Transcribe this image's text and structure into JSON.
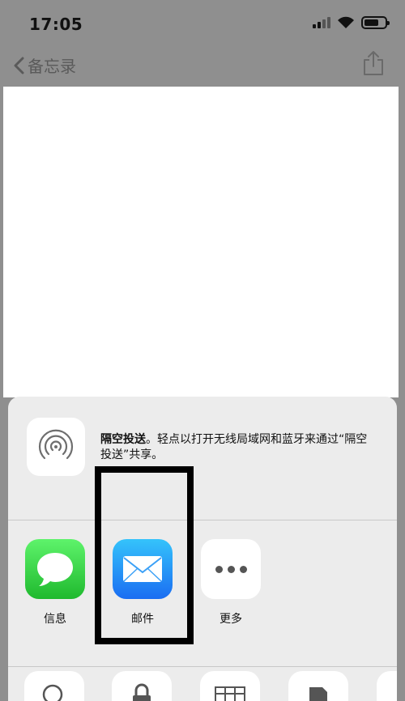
{
  "status_bar": {
    "time": "17:05",
    "signal_bars": 4,
    "signal_strength": 2,
    "battery_level": 0.7,
    "icons": [
      "cellular-signal-icon",
      "wifi-icon",
      "battery-icon"
    ]
  },
  "nav": {
    "back_label": "备忘录",
    "back_icon": "chevron-left-icon",
    "share_icon": "share-icon"
  },
  "share_sheet": {
    "airdrop": {
      "icon": "airdrop-icon",
      "title": "隔空投送",
      "description": "。轻点以打开无线局域网和蓝牙来通过“隔空投送”共享。"
    },
    "apps": [
      {
        "label": "信息",
        "icon": "messages-icon",
        "color": "#28c83a"
      },
      {
        "label": "邮件",
        "icon": "mail-icon",
        "color": "#1e8cf5"
      },
      {
        "label": "更多",
        "icon": "more-icon",
        "color": "#ffffff"
      }
    ],
    "actions": [
      {
        "icon": "search-icon"
      },
      {
        "icon": "lock-icon"
      },
      {
        "icon": "table-icon"
      },
      {
        "icon": "pdf-icon"
      }
    ]
  },
  "colors": {
    "dimmed_background": "#8f8f8f",
    "sheet_background": "#ececec",
    "highlight_border": "#000000"
  }
}
